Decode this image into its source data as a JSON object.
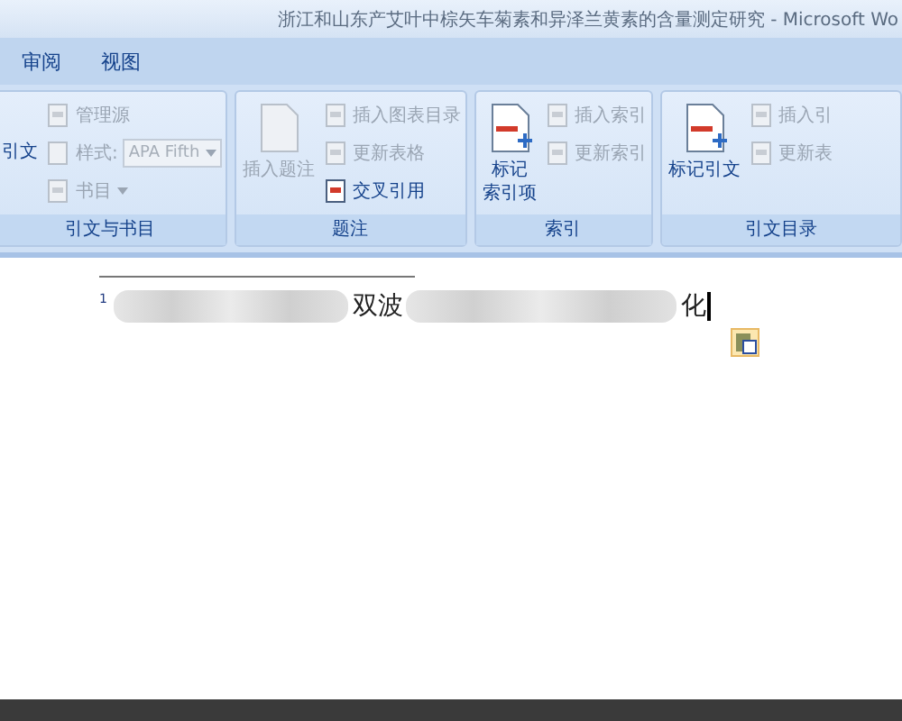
{
  "window": {
    "title": "浙江和山东产艾叶中棕矢车菊素和异泽兰黄素的含量测定研究 - Microsoft Wo"
  },
  "tabs": [
    {
      "label": "审阅",
      "selected": false
    },
    {
      "label": "视图",
      "selected": false
    }
  ],
  "groups": [
    {
      "label": "引文与书目",
      "columns": [
        [
          {
            "kind": "large",
            "label": "引文",
            "disabled": false
          }
        ],
        [
          {
            "kind": "small",
            "label": "管理源",
            "disabled": true
          },
          {
            "kind": "dropdown",
            "label": "样式:",
            "value": "APA Fifth",
            "disabled": true
          },
          {
            "kind": "small",
            "label": "书目",
            "disabled": true,
            "menu": true
          }
        ]
      ]
    },
    {
      "label": "题注",
      "columns": [
        [
          {
            "kind": "large",
            "label": "插入题注",
            "disabled": true
          }
        ],
        [
          {
            "kind": "small",
            "label": "插入图表目录",
            "disabled": true
          },
          {
            "kind": "small",
            "label": "更新表格",
            "disabled": true
          },
          {
            "kind": "small",
            "label": "交叉引用",
            "disabled": false
          }
        ]
      ]
    },
    {
      "label": "索引",
      "columns": [
        [
          {
            "kind": "large",
            "lines": [
              "标记",
              "索引项"
            ],
            "disabled": false
          }
        ],
        [
          {
            "kind": "small",
            "label": "插入索引",
            "disabled": true
          },
          {
            "kind": "small",
            "label": "更新索引",
            "disabled": true
          }
        ]
      ]
    },
    {
      "label": "引文目录",
      "columns": [
        [
          {
            "kind": "large",
            "label": "标记引文",
            "disabled": false
          }
        ],
        [
          {
            "kind": "small",
            "label": "插入引",
            "disabled": true
          },
          {
            "kind": "small",
            "label": "更新表",
            "disabled": true
          }
        ]
      ]
    }
  ],
  "document": {
    "footnote": {
      "marker": "1",
      "parts": [
        {
          "kind": "blur"
        },
        {
          "kind": "text",
          "text": "双波"
        },
        {
          "kind": "blur"
        },
        {
          "kind": "text",
          "text": "化"
        }
      ]
    }
  }
}
